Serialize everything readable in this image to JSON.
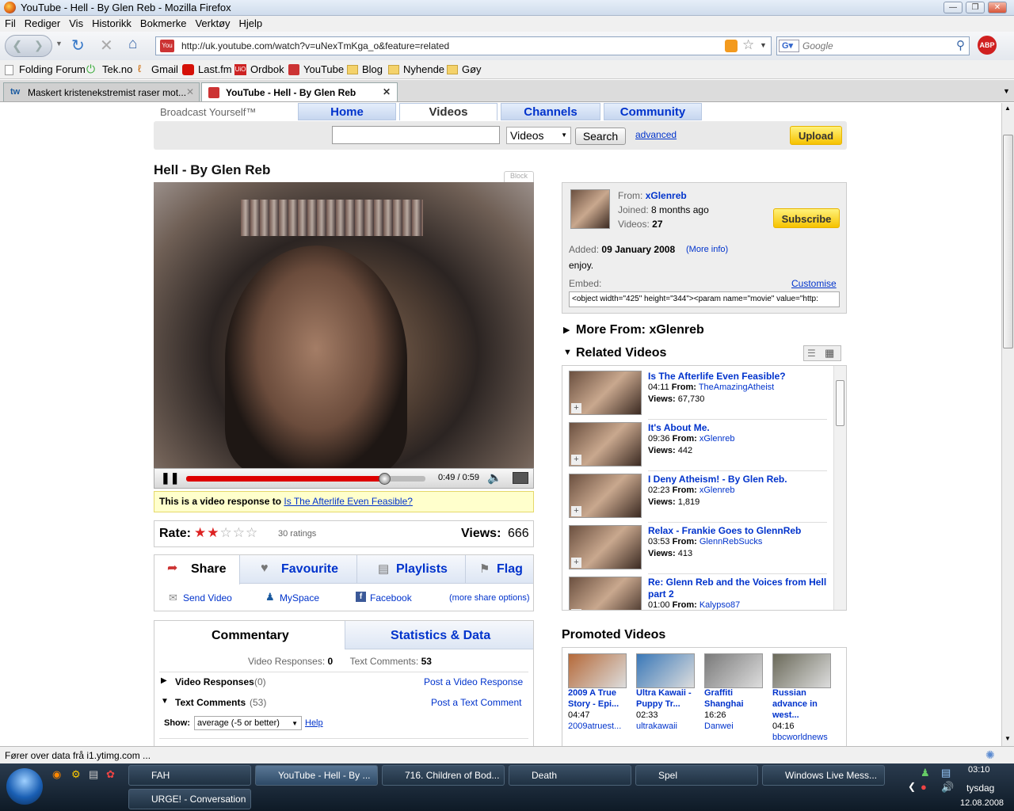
{
  "window": {
    "title": "YouTube - Hell - By Glen Reb - Mozilla Firefox"
  },
  "menu": [
    "Fil",
    "Rediger",
    "Vis",
    "Historikk",
    "Bokmerke",
    "Verktøy",
    "Hjelp"
  ],
  "nav": {
    "url": "http://uk.youtube.com/watch?v=uNexTmKga_o&feature=related",
    "search_placeholder": "Google"
  },
  "bookmarks": [
    "Folding Forum",
    "Tek.no",
    "Gmail",
    "Last.fm",
    "Ordbok",
    "YouTube",
    "Blog",
    "Nyhende",
    "Gøy"
  ],
  "tabs": [
    {
      "label": "Maskert kristenekstremist raser mot..."
    },
    {
      "label": "YouTube - Hell - By Glen Reb"
    }
  ],
  "yt": {
    "tagline": "Broadcast Yourself™",
    "navtabs": [
      "Home",
      "Videos",
      "Channels",
      "Community"
    ],
    "search_scope": "Videos",
    "search_btn": "Search",
    "advanced": "advanced",
    "upload": "Upload",
    "title": "Hell - By Glen Reb",
    "block": "Block",
    "time": "0:49 / 0:59",
    "progress": 0.83,
    "response_prefix": "This is a video response to",
    "response_link": "Is The Afterlife Even Feasible?",
    "rate_label": "Rate:",
    "ratings": "30 ratings",
    "rating_value": 2,
    "views_label": "Views:",
    "views": "666",
    "share": {
      "share": "Share",
      "favourite": "Favourite",
      "playlists": "Playlists",
      "flag": "Flag",
      "send": "Send Video",
      "myspace": "MySpace",
      "facebook": "Facebook",
      "more": "(more share options)"
    },
    "comm": {
      "tab1": "Commentary",
      "tab2": "Statistics & Data",
      "vr_label": "Video Responses:",
      "vr": "0",
      "tc_label": "Text Comments:",
      "tc": "53",
      "vr_row": "Video Responses",
      "vr_count": "(0)",
      "post_vr": "Post a Video Response",
      "tc_row": "Text Comments",
      "tc_count": "(53)",
      "post_tc": "Post a Text Comment",
      "show": "Show:",
      "show_val": "average (-5 or better)",
      "help": "Help"
    },
    "info": {
      "from_label": "From:",
      "from": "xGlenreb",
      "joined_label": "Joined:",
      "joined": "8 months ago",
      "videos_label": "Videos:",
      "videos": "27",
      "subscribe": "Subscribe",
      "added_label": "Added:",
      "added": "09 January 2008",
      "more_info": "(More info)",
      "desc": "enjoy.",
      "embed": "Embed:",
      "customise": "Customise",
      "embed_code": "<object width=\"425\" height=\"344\"><param name=\"movie\" value=\"http:"
    },
    "more_from": "More From: xGlenreb",
    "related_title": "Related Videos",
    "related": [
      {
        "title": "Is The Afterlife Even Feasible?",
        "title2": "",
        "dur": "04:11",
        "from": "TheAmazingAtheist",
        "views": "67,730"
      },
      {
        "title": "It's About Me.",
        "title2": "",
        "dur": "09:36",
        "from": "xGlenreb",
        "views": "442"
      },
      {
        "title": "I Deny Atheism! - By Glen Reb.",
        "title2": "",
        "dur": "02:23",
        "from": "xGlenreb",
        "views": "1,819"
      },
      {
        "title": "Relax - Frankie Goes to GlennReb",
        "title2": "",
        "dur": "03:53",
        "from": "GlennRebSucks",
        "views": "413"
      },
      {
        "title": "Re: Glenn Reb and the Voices from Hell",
        "title2": "part 2",
        "dur": "01:00",
        "from": "Kalypso87",
        "views": ""
      }
    ],
    "from_word": "From:",
    "views_word": "Views:",
    "promoted_title": "Promoted Videos",
    "promoted": [
      {
        "t1": "2009 A True",
        "t2": "Story - Epi...",
        "t3": "",
        "dur": "04:47",
        "user": "2009atruest..."
      },
      {
        "t1": "Ultra Kawaii -",
        "t2": "Puppy Tr...",
        "t3": "",
        "dur": "02:33",
        "user": "ultrakawaii"
      },
      {
        "t1": "Graffiti",
        "t2": "Shanghai",
        "t3": "",
        "dur": "16:26",
        "user": "Danwei"
      },
      {
        "t1": "Russian",
        "t2": "advance in",
        "t3": "west...",
        "dur": "04:16",
        "user": "bbcworldnews"
      }
    ]
  },
  "status": "Fører over data frå i1.ytimg.com ...",
  "taskbar": {
    "items": [
      "FAH",
      "YouTube - Hell - By ...",
      "716. Children of Bod...",
      "Death",
      "Spel",
      "Windows Live Mess...",
      "URGE! - Conversation"
    ],
    "time": "03:10",
    "day": "tysdag",
    "date": "12.08.2008"
  }
}
